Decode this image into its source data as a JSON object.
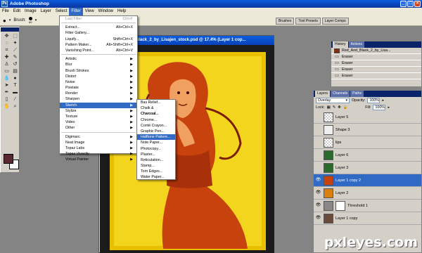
{
  "app": {
    "title": "Adobe Photoshop",
    "colors": {
      "accent": "#316ac5",
      "titlebar": "#0842b8",
      "fg_swatch": "#5b2832"
    }
  },
  "menubar": [
    "File",
    "Edit",
    "Image",
    "Layer",
    "Select",
    "Filter",
    "View",
    "Window",
    "Help"
  ],
  "options": {
    "brush_label": "Brush:",
    "brush_size": "60"
  },
  "well_tabs": [
    "Brushes",
    "Tool Presets",
    "Layer Comps"
  ],
  "document": {
    "title": "Black_2_by_Lisajen_stock.psd @ 17.4% (Layer 1 cop..."
  },
  "filter_menu": [
    {
      "label": "Last Filter",
      "shortcut": "Ctrl+F",
      "disabled": true
    },
    {
      "sep": true
    },
    {
      "label": "Extract...",
      "shortcut": "Alt+Ctrl+X"
    },
    {
      "label": "Filter Gallery..."
    },
    {
      "label": "Liquify...",
      "shortcut": "Shift+Ctrl+X"
    },
    {
      "label": "Pattern Maker...",
      "shortcut": "Alt+Shift+Ctrl+X"
    },
    {
      "label": "Vanishing Point...",
      "shortcut": "Alt+Ctrl+V"
    },
    {
      "sep": true
    },
    {
      "label": "Artistic",
      "sub": true
    },
    {
      "label": "Blur",
      "sub": true
    },
    {
      "label": "Brush Strokes",
      "sub": true
    },
    {
      "label": "Distort",
      "sub": true
    },
    {
      "label": "Noise",
      "sub": true
    },
    {
      "label": "Pixelate",
      "sub": true
    },
    {
      "label": "Render",
      "sub": true
    },
    {
      "label": "Sharpen",
      "sub": true
    },
    {
      "label": "Sketch",
      "sub": true,
      "highlight": true
    },
    {
      "label": "Stylize",
      "sub": true
    },
    {
      "label": "Texture",
      "sub": true
    },
    {
      "label": "Video",
      "sub": true
    },
    {
      "label": "Other",
      "sub": true
    },
    {
      "sep": true
    },
    {
      "label": "Digimarc",
      "sub": true
    },
    {
      "label": "Neat Image",
      "sub": true
    },
    {
      "label": "Topaz Labs",
      "sub": true
    },
    {
      "label": "Topaz Vivacity",
      "sub": true
    },
    {
      "label": "Virtual Painter",
      "sub": true
    }
  ],
  "sketch_submenu": [
    {
      "label": "Bas Relief..."
    },
    {
      "label": "Chalk & Charcoal..."
    },
    {
      "label": "Charcoal..."
    },
    {
      "label": "Chrome..."
    },
    {
      "label": "Conté Crayon..."
    },
    {
      "label": "Graphic Pen..."
    },
    {
      "label": "Halftone Pattern...",
      "highlight": true
    },
    {
      "label": "Note Paper..."
    },
    {
      "label": "Photocopy..."
    },
    {
      "label": "Plaster..."
    },
    {
      "label": "Reticulation..."
    },
    {
      "label": "Stamp..."
    },
    {
      "label": "Torn Edges..."
    },
    {
      "label": "Water Paper..."
    }
  ],
  "history": {
    "tabs": [
      "History",
      "Actions"
    ],
    "snapshot": "Red_And_Black_2_by_Lisa...",
    "steps": [
      "Eraser",
      "Eraser",
      "Eraser",
      "Eraser"
    ]
  },
  "layers": {
    "tabs": [
      "Layers",
      "Channels",
      "Paths"
    ],
    "blend_mode": "Overlay",
    "opacity_label": "Opacity:",
    "opacity": "100%",
    "lock_label": "Lock:",
    "fill_label": "Fill:",
    "fill": "100%",
    "rows": [
      {
        "name": "Layer 5",
        "thumb": "checker",
        "eye": false
      },
      {
        "name": "Shape 3",
        "thumb": "shape",
        "eye": false
      },
      {
        "name": "lips",
        "thumb": "checker",
        "eye": false
      },
      {
        "name": "Layer 6",
        "thumb": "green",
        "eye": false
      },
      {
        "name": "Layer 3",
        "thumb": "green",
        "eye": false
      },
      {
        "name": "Layer 1 copy 2",
        "thumb": "red",
        "eye": true,
        "selected": true
      },
      {
        "name": "Layer 2",
        "thumb": "orange",
        "eye": true
      },
      {
        "name": "Threshold 1",
        "thumb": "adjust",
        "eye": true
      },
      {
        "name": "Layer 1 copy",
        "thumb": "photo",
        "eye": true
      }
    ]
  },
  "watermark": "pxleyes.com"
}
